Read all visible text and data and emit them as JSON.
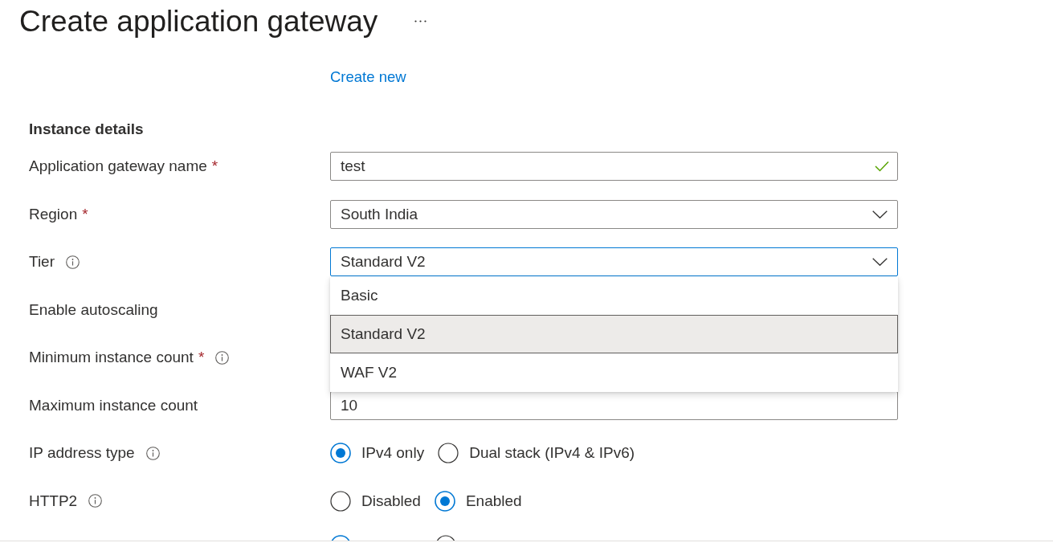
{
  "page": {
    "title": "Create application gateway",
    "more_menu": true
  },
  "create_new_link": "Create new",
  "section": {
    "heading": "Instance details"
  },
  "fields": [
    {
      "kind": "text",
      "label": "Application gateway name",
      "required_mark": "*",
      "value": "test",
      "valid": true
    },
    {
      "kind": "select",
      "label": "Region",
      "required_mark": "*",
      "value": "South India",
      "focused": false
    },
    {
      "kind": "select",
      "label": "Tier",
      "info": true,
      "value": "Standard V2",
      "focused": true,
      "expanded": true,
      "options": [
        {
          "label": "Basic",
          "selected": false
        },
        {
          "label": "Standard V2",
          "selected": true
        },
        {
          "label": "WAF V2",
          "selected": false
        }
      ]
    },
    {
      "kind": "covered",
      "label": "Enable autoscaling"
    },
    {
      "kind": "covered",
      "label": "Minimum instance count",
      "required_mark": "*",
      "info": true
    },
    {
      "kind": "text",
      "label": "Maximum instance count",
      "value": "10"
    },
    {
      "kind": "radio",
      "label": "IP address type",
      "info": true,
      "options": [
        {
          "label": "IPv4 only",
          "selected": true
        },
        {
          "label": "Dual stack (IPv4 & IPv6)",
          "selected": false
        }
      ]
    },
    {
      "kind": "radio",
      "label": "HTTP2",
      "info": true,
      "options": [
        {
          "label": "Disabled",
          "selected": false
        },
        {
          "label": "Enabled",
          "selected": true
        }
      ]
    },
    {
      "kind": "radio",
      "options": [
        {
          "selected": true
        },
        {
          "selected": false
        }
      ]
    }
  ]
}
